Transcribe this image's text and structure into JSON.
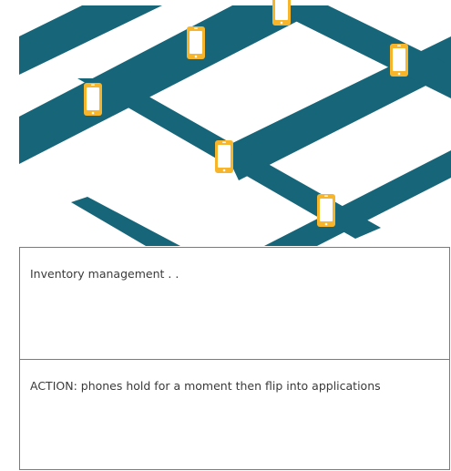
{
  "colors": {
    "road": "#176579",
    "phone_body": "#f7b52b",
    "phone_screen": "#ffffff",
    "background": "#ffffff",
    "panel_border": "#7a7a7a",
    "text": "#3a3a3a"
  },
  "illustration": {
    "icon_name": "smartphone-icon"
  },
  "storyboard": {
    "description": "Inventory management . .",
    "action": "ACTION: phones hold for a moment then flip into applications"
  }
}
